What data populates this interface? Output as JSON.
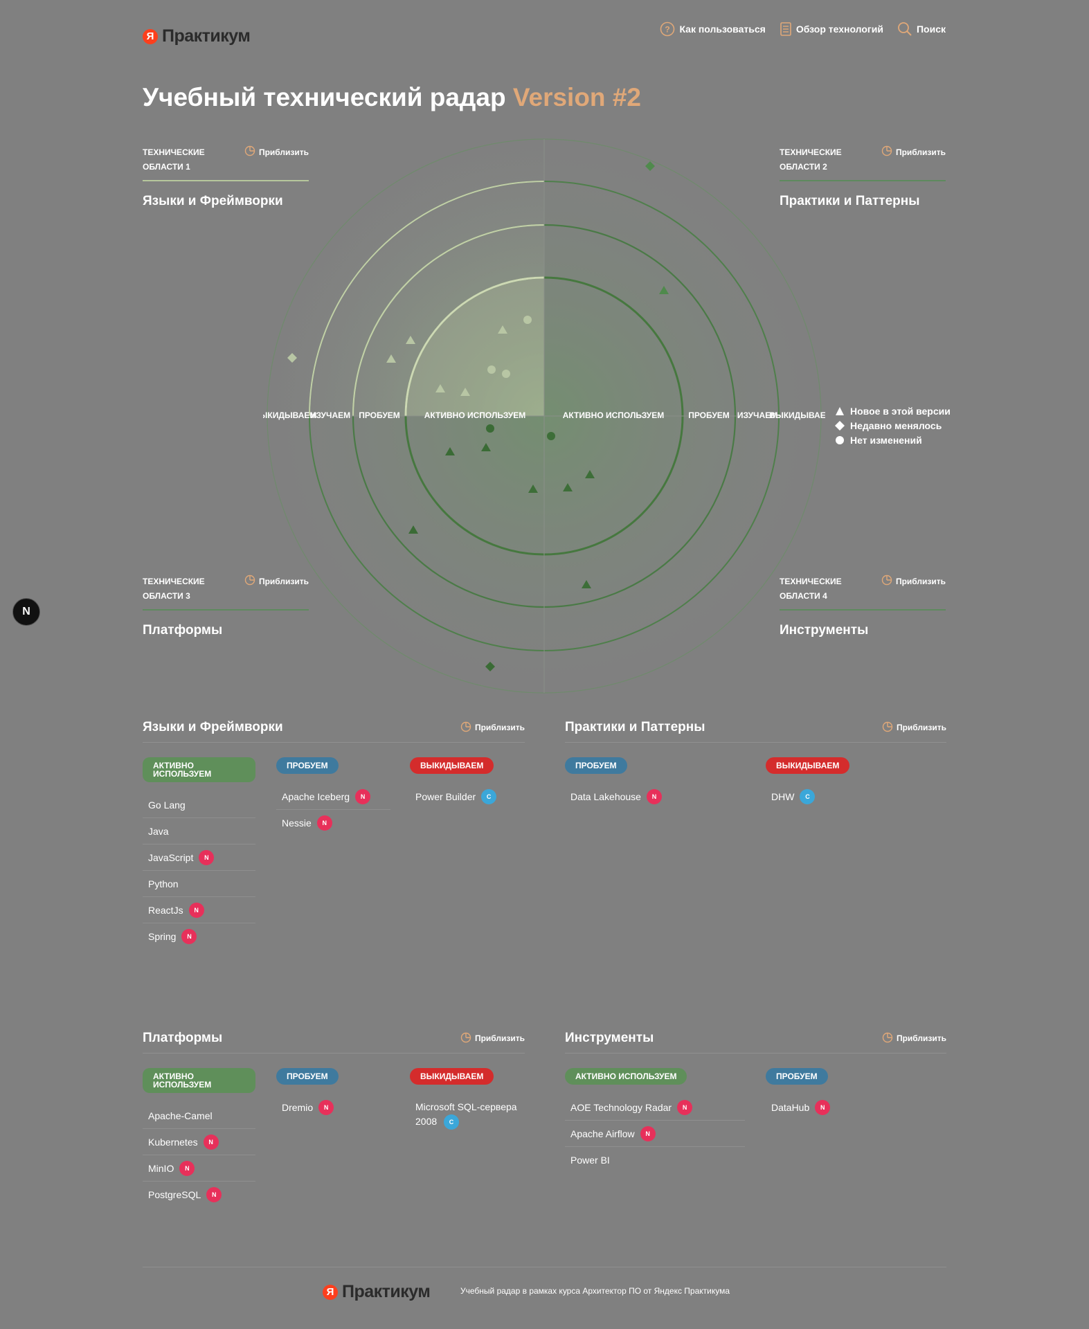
{
  "header": {
    "logo_mark": "Я",
    "logo_text": "Практикум",
    "nav": [
      {
        "label": "Как пользоваться",
        "icon": "help-circle-icon"
      },
      {
        "label": "Обзор технологий",
        "icon": "document-list-icon"
      },
      {
        "label": "Поиск",
        "icon": "search-icon"
      }
    ]
  },
  "title": {
    "main": "Учебный технический радар",
    "version": "Version #2"
  },
  "quadrants": [
    {
      "label": "Технические области 1",
      "name": "Языки и Фреймворки",
      "zoom": "Приблизить"
    },
    {
      "label": "Технические области 2",
      "name": "Практики и Паттерны",
      "zoom": "Приблизить"
    },
    {
      "label": "Технические области 3",
      "name": "Платформы",
      "zoom": "Приблизить"
    },
    {
      "label": "Технические области 4",
      "name": "Инструменты",
      "zoom": "Приблизить"
    }
  ],
  "radar": {
    "rings_left": [
      "ЫКИДЫВАЕМ",
      "ИЗУЧАЕМ",
      "ПРОБУЕМ",
      "АКТИВНО ИСПОЛЬЗУЕМ"
    ],
    "rings_right": [
      "АКТИВНО ИСПОЛЬЗУЕМ",
      "ПРОБУЕМ",
      "ИЗУЧАЕМ",
      "ВЫКИДЫВАЕ"
    ]
  },
  "legend": [
    {
      "label": "Новое в этой версии",
      "shape": "triangle"
    },
    {
      "label": "Недавно менялось",
      "shape": "diamond"
    },
    {
      "label": "Нет изменений",
      "shape": "circle"
    }
  ],
  "sections": [
    {
      "title": "Языки и Фреймворки",
      "zoom": "Приблизить",
      "columns": [
        {
          "ring": "Активно используем",
          "kind": "adopt",
          "items": [
            {
              "name": "Go Lang",
              "badge": ""
            },
            {
              "name": "Java",
              "badge": ""
            },
            {
              "name": "JavaScript",
              "badge": "N"
            },
            {
              "name": "Python",
              "badge": ""
            },
            {
              "name": "ReactJs",
              "badge": "N"
            },
            {
              "name": "Spring",
              "badge": "N"
            }
          ]
        },
        {
          "ring": "Пробуем",
          "kind": "trial",
          "items": [
            {
              "name": "Apache Iceberg",
              "badge": "N"
            },
            {
              "name": "Nessie",
              "badge": "N"
            }
          ]
        },
        {
          "ring": "Выкидываем",
          "kind": "hold",
          "items": [
            {
              "name": "Power Builder",
              "badge": "C"
            }
          ]
        }
      ]
    },
    {
      "title": "Практики и Паттерны",
      "zoom": "Приблизить",
      "columns": [
        {
          "ring": "Пробуем",
          "kind": "trial",
          "items": [
            {
              "name": "Data Lakehouse",
              "badge": "N"
            }
          ]
        },
        {
          "ring": "Выкидываем",
          "kind": "hold",
          "items": [
            {
              "name": "DHW",
              "badge": "C"
            }
          ]
        }
      ]
    },
    {
      "title": "Платформы",
      "zoom": "Приблизить",
      "columns": [
        {
          "ring": "Активно используем",
          "kind": "adopt",
          "items": [
            {
              "name": "Apache-Camel",
              "badge": ""
            },
            {
              "name": "Kubernetes",
              "badge": "N"
            },
            {
              "name": "MinIO",
              "badge": "N"
            },
            {
              "name": "PostgreSQL",
              "badge": "N"
            }
          ]
        },
        {
          "ring": "Пробуем",
          "kind": "trial",
          "items": [
            {
              "name": "Dremio",
              "badge": "N"
            }
          ]
        },
        {
          "ring": "Выкидываем",
          "kind": "hold",
          "items": [
            {
              "name": "Microsoft SQL-сервера 2008",
              "badge": "C"
            }
          ]
        }
      ]
    },
    {
      "title": "Инструменты",
      "zoom": "Приблизить",
      "columns": [
        {
          "ring": "Активно используем",
          "kind": "adopt",
          "items": [
            {
              "name": "AOE Technology Radar",
              "badge": "N"
            },
            {
              "name": "Apache Airflow",
              "badge": "N"
            },
            {
              "name": "Power BI",
              "badge": ""
            }
          ]
        },
        {
          "ring": "Пробуем",
          "kind": "trial",
          "items": [
            {
              "name": "DataHub",
              "badge": "N"
            }
          ]
        }
      ]
    }
  ],
  "footer": {
    "logo_mark": "Я",
    "logo_text": "Практикум",
    "text": "Учебный радар в рамках курса Архитектор ПО от Яндекс Практикума"
  },
  "dev_badge": "N"
}
